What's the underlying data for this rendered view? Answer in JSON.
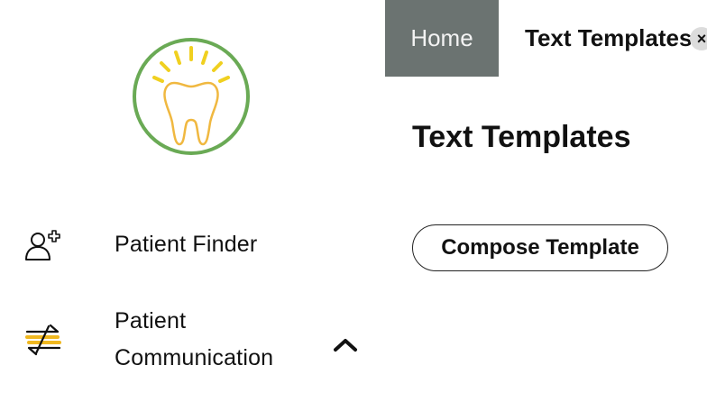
{
  "sidebar": {
    "logo_icon": "tooth-logo-icon",
    "items": [
      {
        "label": "Patient Finder",
        "icon": "person-add-icon"
      },
      {
        "label_line1": "Patient",
        "label_line2": "Communication",
        "icon": "exchange-arrows-icon",
        "expanded": true
      }
    ]
  },
  "tabs": {
    "home_label": "Home",
    "active_label": "Text Templates",
    "close_glyph": "×"
  },
  "main": {
    "title": "Text Templates",
    "compose_button_label": "Compose Template"
  },
  "colors": {
    "tab_inactive_bg": "#6b7371",
    "logo_ring": "#6aaa55",
    "accent_yellow": "#f0c020",
    "tooth_outline": "#f0b840"
  }
}
